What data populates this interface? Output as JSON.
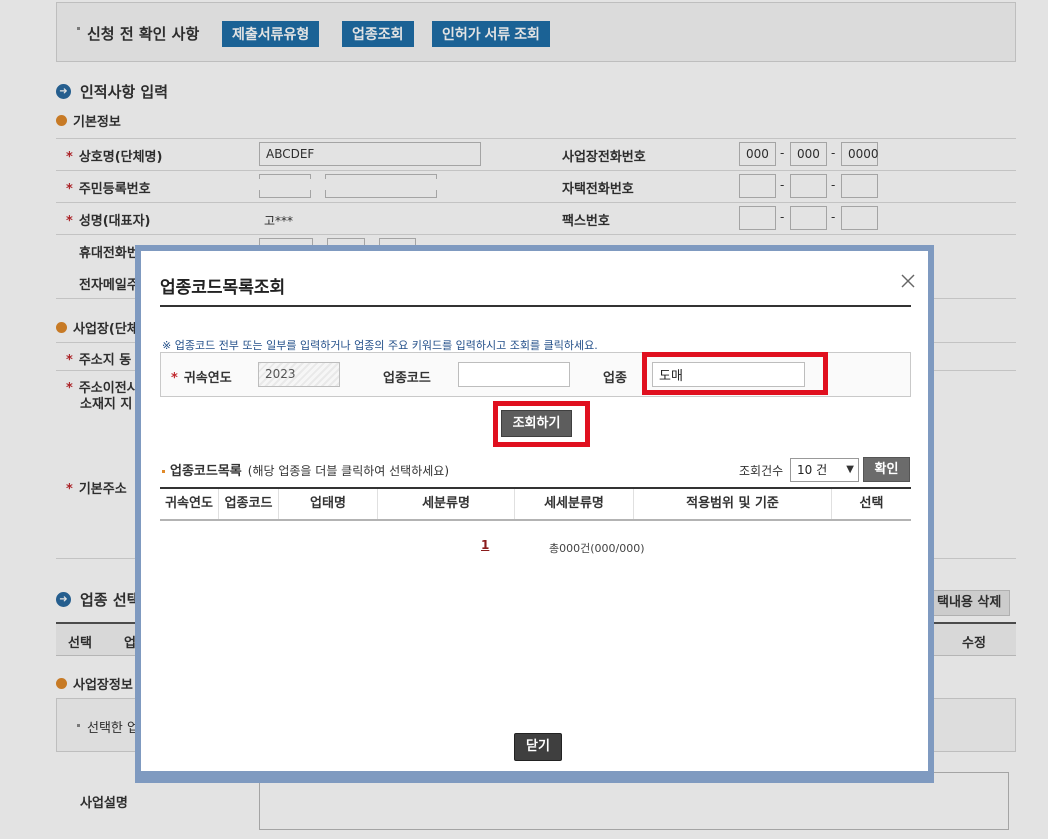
{
  "background": {
    "pre_check": {
      "label": "신청 전 확인 사항",
      "buttons": [
        "제출서류유형",
        "업종조회",
        "인허가 서류 조회"
      ]
    },
    "section_personal": "인적사항 입력",
    "subsection_basic": "기본정보",
    "rows_left": [
      {
        "label": "상호명(단체명)",
        "required": "*"
      },
      {
        "label": "주민등록번호",
        "required": "*"
      },
      {
        "label": "성명(대표자)",
        "required": "*"
      },
      {
        "label": "휴대전화번",
        "required": ""
      },
      {
        "label": "전자메일주",
        "required": ""
      }
    ],
    "rows_right": [
      "사업장전화번호",
      "자택전화번호",
      "팩스번호"
    ],
    "business_name_value": "ABCDEF",
    "rep_name_value": "고***",
    "phone_values": [
      "000",
      "000",
      "0000"
    ],
    "dash": "-",
    "subsection_workplace": "사업장(단체",
    "addr_rows": [
      {
        "label": "주소지 동",
        "required": "*"
      },
      {
        "label": "주소이전시",
        "required": "*"
      },
      {
        "label": "소재지 지",
        "required": ""
      },
      {
        "label": "기본주소",
        "required": "*"
      }
    ],
    "section_business": "업종 선택",
    "delete_selected": "택내용 삭제",
    "table_cols": [
      "선택",
      "업",
      "수정"
    ],
    "subsection_info": "사업장정보",
    "notice_text": "선택한 업",
    "business_desc_label": "사업설명"
  },
  "modal": {
    "title": "업종코드목록조회",
    "help": "※ 업종코드 전부 또는 일부를 입력하거나 업종의 주요 키워드를 입력하시고 조회를 클릭하세요.",
    "year_label": "귀속연도",
    "year_required": "*",
    "year_value": "2023",
    "code_label": "업종코드",
    "code_value": "",
    "industry_label": "업종",
    "industry_value": "도매",
    "search_button": "조회하기",
    "list_title": "업종코드목록",
    "list_hint": "(해당 업종을 더블 클릭하여 선택하세요)",
    "count_label": "조회건수",
    "count_value": "10 건",
    "confirm_button": "확인",
    "columns": [
      "귀속연도",
      "업종코드",
      "업태명",
      "세분류명",
      "세세분류명",
      "적용범위 및 기준",
      "선택"
    ],
    "page_link": "1",
    "total_text": "총000건(000/000)",
    "close_button": "닫기",
    "highlight_color": "#e0101f"
  }
}
